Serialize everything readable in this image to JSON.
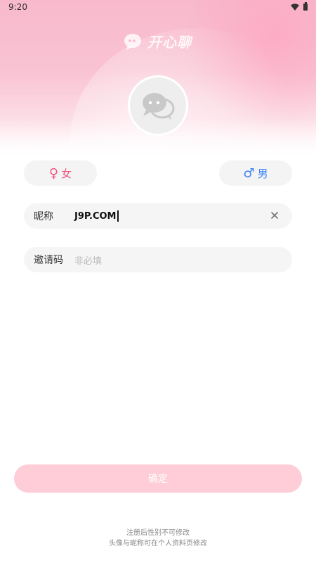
{
  "status_bar": {
    "time": "9:20"
  },
  "header": {
    "logo_text": "开心聊"
  },
  "gender": {
    "female_symbol": "♀",
    "female_label": "女",
    "male_symbol": "♂",
    "male_label": "男"
  },
  "form": {
    "nickname_label": "昵称",
    "nickname_value": "J9P.COM",
    "invite_label": "邀请码",
    "invite_placeholder": "非必填"
  },
  "confirm_label": "确定",
  "notes": {
    "line1": "注册后性别不可修改",
    "line2": "头像与昵称可在个人资料页修改"
  },
  "colors": {
    "female": "#f0537d",
    "male": "#3b82f6",
    "confirm_bg": "#fecdd7",
    "hero_pink": "#f8b9cc"
  }
}
